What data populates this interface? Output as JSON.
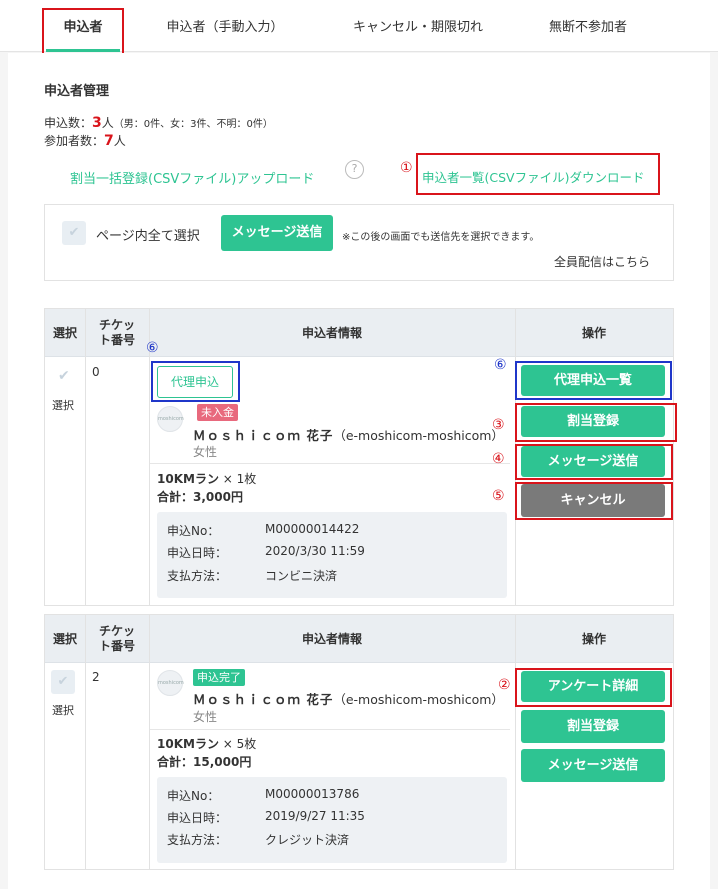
{
  "tabs": [
    {
      "label": "申込者"
    },
    {
      "label": "申込者（手動入力）"
    },
    {
      "label": "キャンセル・期限切れ"
    },
    {
      "label": "無断不参加者"
    }
  ],
  "page_title": "申込者管理",
  "summary": {
    "applications_prefix": "申込数：",
    "applications_count": "3",
    "applications_unit": "人",
    "applications_breakdown": "（男：0件、女：3件、不明：0件）",
    "participants_prefix": "参加者数：",
    "participants_count": "7",
    "participants_unit": "人"
  },
  "links": {
    "csv_upload": "割当一括登録(CSVファイル)アップロード",
    "help": "?",
    "csv_download": "申込者一覧(CSVファイル)ダウンロード",
    "broadcast": "全員配信はこちら"
  },
  "select_panel": {
    "select_all_label": "ページ内全て選択",
    "send_message": "メッセージ送信",
    "note": "※この後の画面でも送信先を選択できます。"
  },
  "markers": {
    "m1": "①",
    "m2": "②",
    "m3": "③",
    "m4": "④",
    "m5": "⑤",
    "m6": "⑥"
  },
  "table_headers": {
    "select": "選択",
    "ticket_no": "チケット番号",
    "applicant_info": "申込者情報",
    "actions": "操作"
  },
  "icons": {
    "check": "✔"
  },
  "applicants": [
    {
      "ticket_no": "0",
      "select_label": "選択",
      "proxy_label": "代理申込",
      "avatar_text": "moshicom",
      "status_badge": "未入金",
      "name": "Ｍｏｓｈｉｃｏｍ 花子",
      "user_id": "（e-moshicom-moshicom）",
      "gender": "女性",
      "item": "10KMラン",
      "qty": " × 1枚",
      "total_label": "合計：",
      "total": "3,000円",
      "details": [
        {
          "label": "申込No：",
          "value": "M00000014422"
        },
        {
          "label": "申込日時：",
          "value": "2020/3/30 11:59"
        },
        {
          "label": "支払方法：",
          "value": "コンビニ決済"
        }
      ],
      "actions": [
        "代理申込一覧",
        "割当登録",
        "メッセージ送信",
        "キャンセル"
      ]
    },
    {
      "ticket_no": "2",
      "select_label": "選択",
      "avatar_text": "moshicom",
      "status_badge": "申込完了",
      "name": "Ｍｏｓｈｉｃｏｍ 花子",
      "user_id": "（e-moshicom-moshicom）",
      "gender": "女性",
      "item": "10KMラン",
      "qty": " × 5枚",
      "total_label": "合計：",
      "total": "15,000円",
      "details": [
        {
          "label": "申込No：",
          "value": "M00000013786"
        },
        {
          "label": "申込日時：",
          "value": "2019/9/27 11:35"
        },
        {
          "label": "支払方法：",
          "value": "クレジット決済"
        }
      ],
      "actions": [
        "アンケート詳細",
        "割当登録",
        "メッセージ送信"
      ]
    }
  ],
  "colors": {
    "accent": "#2ec492",
    "annotation_red": "#d9141b",
    "annotation_blue": "#1f36c9",
    "cancel_gray": "#7a7a7a",
    "unpaid_badge": "#e8697d"
  }
}
